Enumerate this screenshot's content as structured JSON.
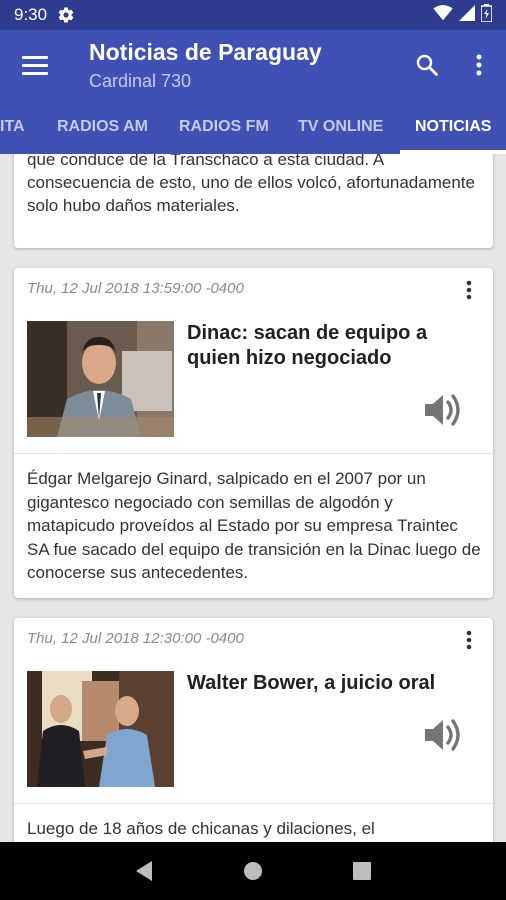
{
  "status_bar": {
    "time": "9:30",
    "icons": [
      "settings-icon",
      "wifi-icon",
      "signal-icon",
      "battery-icon"
    ]
  },
  "app_bar": {
    "title": "Noticias de Paraguay",
    "subtitle": "Cardinal 730",
    "icons": [
      "menu-icon",
      "search-icon",
      "more-vert-icon"
    ]
  },
  "tabs": [
    {
      "label": "ITA",
      "active": false
    },
    {
      "label": "RADIOS AM",
      "active": false
    },
    {
      "label": "RADIOS FM",
      "active": false
    },
    {
      "label": "TV ONLINE",
      "active": false
    },
    {
      "label": "NOTICIAS",
      "active": true
    }
  ],
  "colors": {
    "primary": "#3f51b5",
    "primary_dark": "#2e3b8f",
    "background": "#e6e6e6"
  },
  "articles": [
    {
      "partial_text": "que conduce de la Transchaco a esta ciudad. A consecuencia de esto, uno de ellos volcó, afortunadamente solo hubo daños materiales."
    },
    {
      "date": "Thu, 12 Jul 2018 13:59:00 -0400",
      "title": "Dinac: sacan de equipo a quien hizo negociado",
      "description": "Édgar Melgarejo Ginard, salpicado en el 2007 por un gigantesco negociado con semillas de algodón y matapicudo proveídos al Estado por su empresa Traintec SA fue sacado del equipo de transición en la Dinac luego de conocerse sus antecedentes."
    },
    {
      "date": "Thu, 12 Jul 2018 12:30:00 -0400",
      "title": "Walter Bower, a juicio oral",
      "description": "Luego de 18 años de chicanas y dilaciones, el"
    }
  ]
}
